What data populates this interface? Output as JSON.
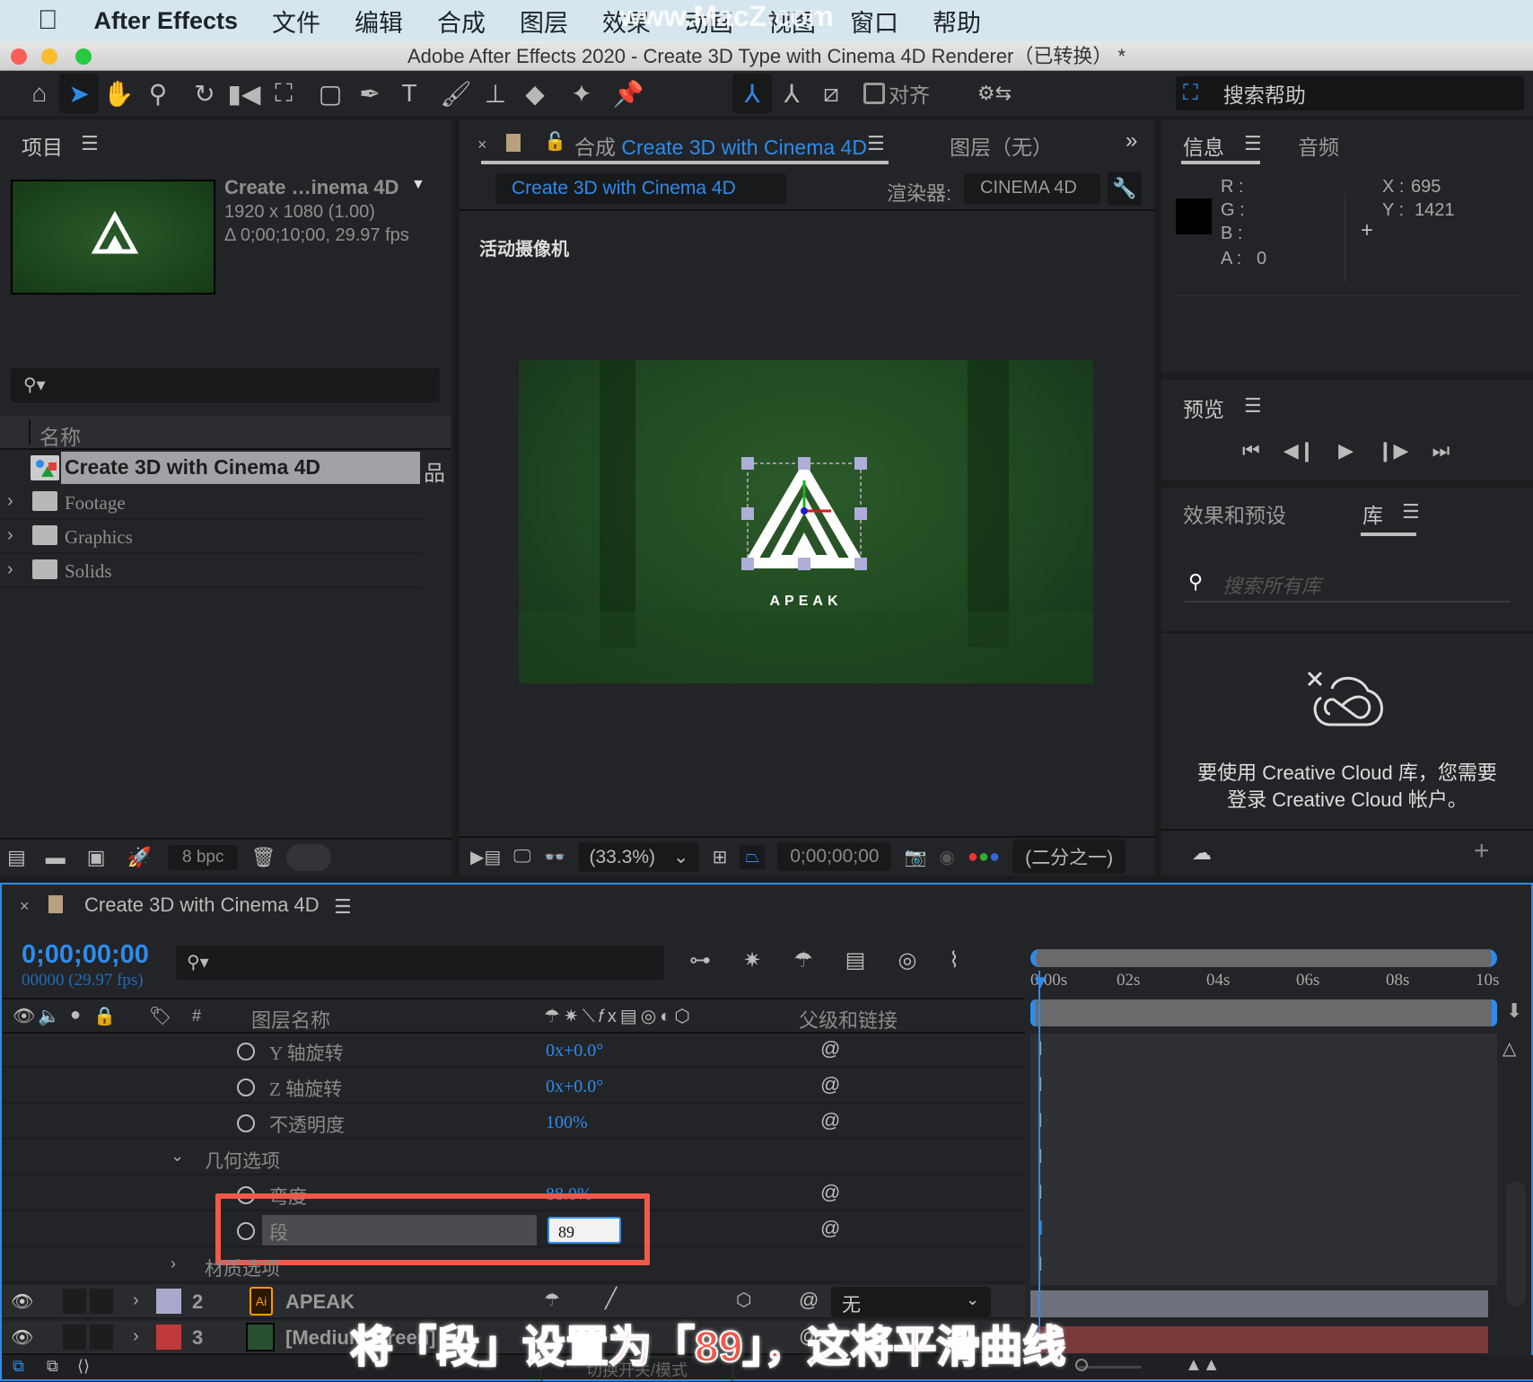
{
  "menubar": {
    "app": "After Effects",
    "items": [
      "文件",
      "编辑",
      "合成",
      "图层",
      "效果",
      "动画",
      "视图",
      "窗口",
      "帮助"
    ],
    "watermark": "www.MacZ.com"
  },
  "window": {
    "title": "Adobe After Effects 2020 - Create 3D Type with Cinema 4D Renderer（已转换） *"
  },
  "toolbar": {
    "tools": [
      "home-icon",
      "selection-icon",
      "hand-icon",
      "zoom-icon",
      "rotate-icon",
      "camera-icon",
      "pan-behind-icon",
      "rectangle-icon",
      "pen-icon",
      "type-icon",
      "brush-icon",
      "clone-stamp-icon",
      "eraser-icon",
      "puppet-icon",
      "pin-icon"
    ],
    "align_label": "对齐",
    "search_help": "搜索帮助"
  },
  "project": {
    "title": "项目",
    "comp_name": "Create …inema 4D",
    "comp_dims": "1920 x 1080 (1.00)",
    "comp_duration": "Δ 0;00;10;00, 29.97 fps",
    "column_name": "名称",
    "items": [
      {
        "name": "Create 3D with Cinema 4D",
        "type": "composition",
        "selected": true
      },
      {
        "name": "Footage",
        "type": "folder"
      },
      {
        "name": "Graphics",
        "type": "folder"
      },
      {
        "name": "Solids",
        "type": "folder"
      }
    ],
    "bpc": "8 bpc"
  },
  "composition": {
    "tab_prefix": "合成",
    "tab_name": "Create 3D with Cinema 4D",
    "layer_tab": "图层（无）",
    "crumb": "Create 3D with Cinema 4D",
    "renderer_label": "渲染器:",
    "renderer_value": "CINEMA 4D",
    "camera_label": "活动摄像机",
    "logo_text": "APEAK",
    "zoom": "(33.3%)",
    "timecode": "0;00;00;00",
    "resolution": "(二分之一)"
  },
  "info": {
    "tab_info": "信息",
    "tab_audio": "音频",
    "r_label": "R :",
    "g_label": "G :",
    "b_label": "B :",
    "a_label": "A :",
    "a_value": "0",
    "x_label": "X :",
    "x_value": "695",
    "y_label": "Y :",
    "y_value": "1421"
  },
  "preview": {
    "title": "预览"
  },
  "libraries": {
    "tab_effects": "效果和预设",
    "tab_library": "库",
    "search_placeholder": "搜索所有库",
    "message_line1": "要使用 Creative Cloud 库，您需要",
    "message_line2": "登录 Creative Cloud 帐户。"
  },
  "timeline": {
    "comp_name": "Create 3D with Cinema 4D",
    "timecode": "0;00;00;00",
    "frame_info": "00000 (29.97 fps)",
    "col_number": "#",
    "col_layer_name": "图层名称",
    "col_parent": "父级和链接",
    "ruler": [
      "0:00s",
      "02s",
      "04s",
      "06s",
      "08s",
      "10s"
    ],
    "properties": [
      {
        "name": "Y 轴旋转",
        "value": "0x+0.0°"
      },
      {
        "name": "Z 轴旋转",
        "value": "0x+0.0°"
      },
      {
        "name": "不透明度",
        "value": "100%"
      }
    ],
    "group_geometry": "几何选项",
    "bevel": {
      "name": "弯度",
      "value": "88.0%"
    },
    "segments": {
      "name": "段",
      "value": "89"
    },
    "group_material": "材质选项",
    "layers": [
      {
        "num": "2",
        "name": "APEAK",
        "color": "#a8a9cc",
        "parent": "无"
      },
      {
        "num": "3",
        "name": "[Medium Green]",
        "color": "#c0393b"
      }
    ],
    "toggle_label": "切换开关/模式"
  },
  "caption": "将「段」设置为「89」，这将平滑曲线"
}
